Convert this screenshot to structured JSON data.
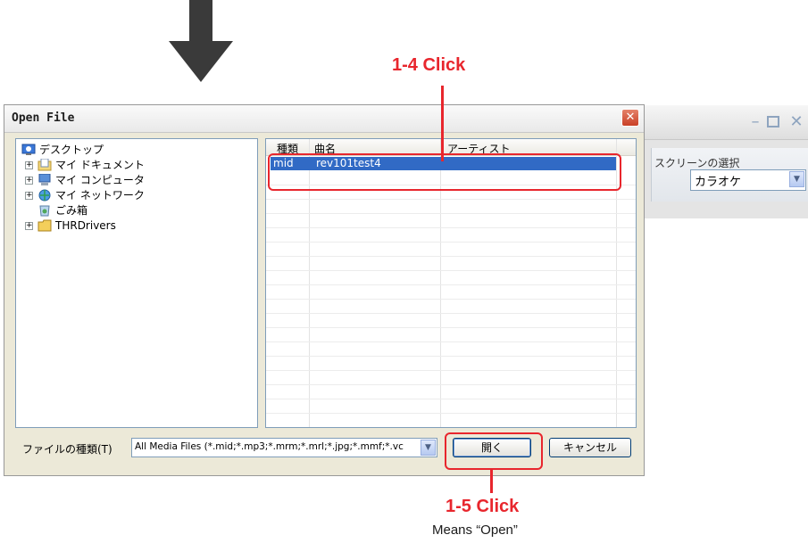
{
  "callouts": {
    "step_1_4": "1-4 Click",
    "step_1_5": "1-5 Click",
    "step_1_5_note": "Means “Open”"
  },
  "background_window": {
    "screen_select_label": "スクリーンの選択",
    "screen_select_value": "カラオケ"
  },
  "dialog": {
    "title": "Open File",
    "tree": {
      "items": [
        {
          "label": "デスクトップ",
          "icon": "desktop-icon"
        },
        {
          "label": "マイ ドキュメント",
          "icon": "my-documents-icon"
        },
        {
          "label": "マイ コンピュータ",
          "icon": "my-computer-icon"
        },
        {
          "label": "マイ ネットワーク",
          "icon": "network-icon"
        },
        {
          "label": "ごみ箱",
          "icon": "recycle-bin-icon"
        },
        {
          "label": "THRDrivers",
          "icon": "folder-icon"
        }
      ]
    },
    "file_list": {
      "columns": [
        "種類",
        "曲名",
        "アーティスト"
      ],
      "rows": [
        {
          "type": "mid",
          "title": "rev101test4",
          "artist": ""
        }
      ]
    },
    "file_type_label": "ファイルの種類(T)",
    "file_type_value": "All Media Files (*.mid;*.mp3;*.mrm;*.mrl;*.jpg;*.mmf;*.vc",
    "open_button": "開く",
    "cancel_button": "キャンセル"
  },
  "colors": {
    "callout_red": "#e8262d",
    "selection_blue": "#316ac5"
  }
}
